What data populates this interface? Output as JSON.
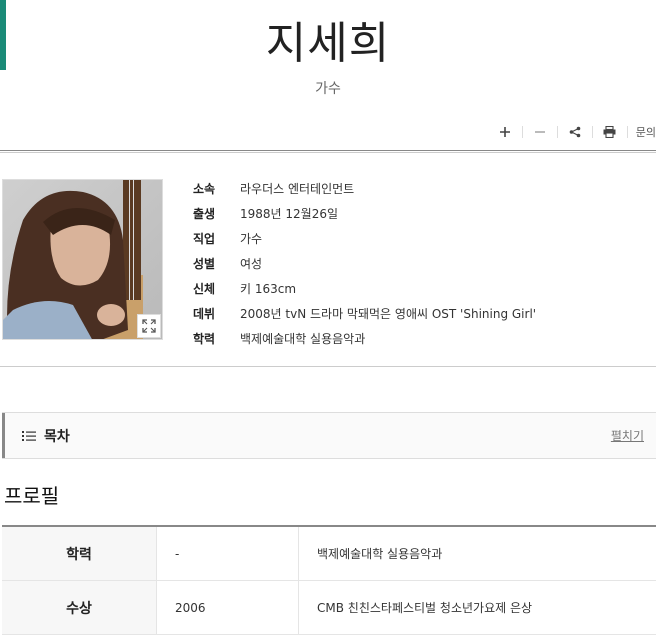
{
  "header": {
    "name": "지세희",
    "occupation": "가수"
  },
  "toolbar": {
    "contact_label": "문의"
  },
  "info": [
    {
      "key": "소속",
      "value": "라우더스 엔터테인먼트"
    },
    {
      "key": "출생",
      "value": "1988년 12월26일"
    },
    {
      "key": "직업",
      "value": "가수"
    },
    {
      "key": "성별",
      "value": "여성"
    },
    {
      "key": "신체",
      "value": "키 163cm"
    },
    {
      "key": "데뷔",
      "value": "2008년 tvN 드라마 막돼먹은 영애씨 OST 'Shining Girl'"
    },
    {
      "key": "학력",
      "value": "백제예술대학 실용음악과"
    }
  ],
  "toc": {
    "title": "목차",
    "toggle": "펼치기"
  },
  "profile": {
    "title": "프로필",
    "rows": [
      {
        "category": "학력",
        "year": "-",
        "detail": "백제예술대학 실용음악과"
      },
      {
        "category": "수상",
        "year": "2006",
        "detail": "CMB 친친스타페스티벌 청소년가요제 은상"
      }
    ]
  },
  "colors": {
    "accent": "#1a8b78"
  }
}
